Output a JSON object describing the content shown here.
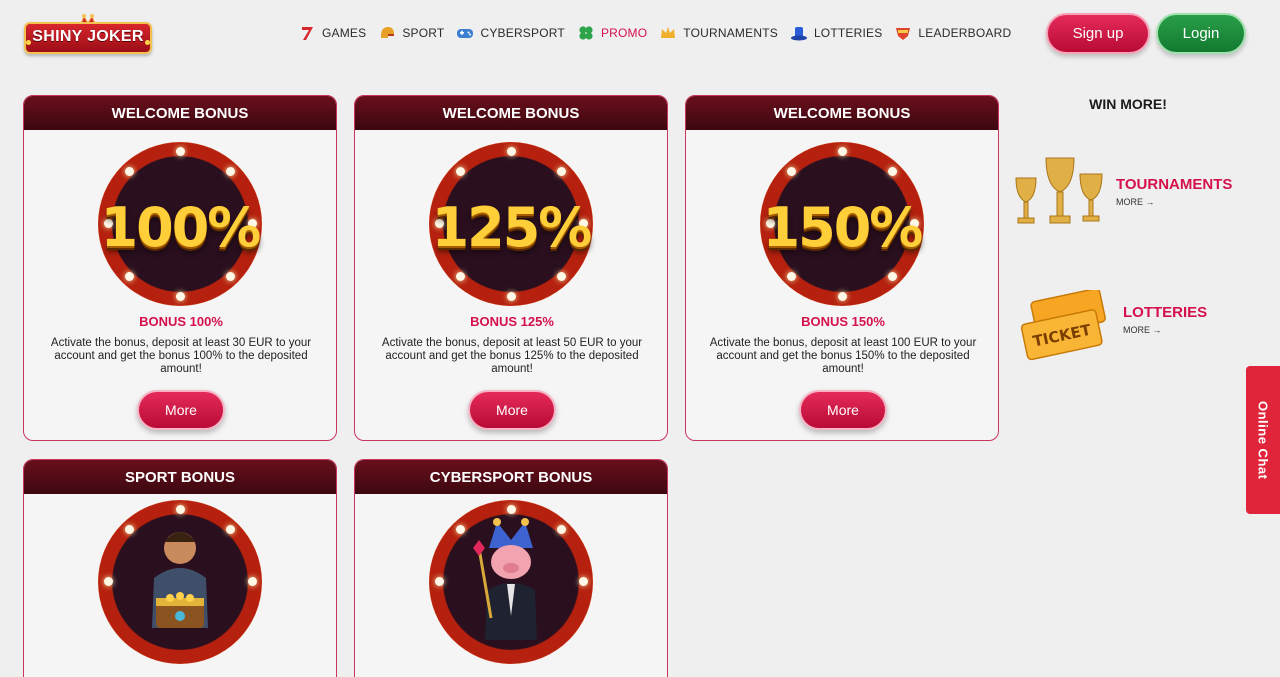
{
  "logo": {
    "text": "SHINY JOKER"
  },
  "nav": {
    "items": [
      {
        "label": "GAMES",
        "icon": "seven-icon",
        "active": false
      },
      {
        "label": "SPORT",
        "icon": "helmet-icon",
        "active": false
      },
      {
        "label": "CYBERSPORT",
        "icon": "gamepad-icon",
        "active": false
      },
      {
        "label": "PROMO",
        "icon": "clover-icon",
        "active": true
      },
      {
        "label": "TOURNAMENTS",
        "icon": "crown-icon",
        "active": false
      },
      {
        "label": "LOTTERIES",
        "icon": "top-hat-icon",
        "active": false
      },
      {
        "label": "LEADERBOARD",
        "icon": "badge-icon",
        "active": false
      }
    ]
  },
  "auth": {
    "signup_label": "Sign up",
    "login_label": "Login"
  },
  "cards": [
    {
      "header": "WELCOME BONUS",
      "badge": "100%",
      "title": "BONUS 100%",
      "desc": "Activate the bonus, deposit at least 30 EUR to your account and get the bonus 100% to the deposited amount!",
      "button": "More"
    },
    {
      "header": "WELCOME BONUS",
      "badge": "125%",
      "title": "BONUS 125%",
      "desc": "Activate the bonus, deposit at least 50 EUR to your account and get the bonus 125% to the deposited amount!",
      "button": "More"
    },
    {
      "header": "WELCOME BONUS",
      "badge": "150%",
      "title": "BONUS 150%",
      "desc": "Activate the bonus, deposit at least 100 EUR to your account and get the bonus 150% to the deposited amount!",
      "button": "More"
    },
    {
      "header": "SPORT BONUS"
    },
    {
      "header": "CYBERSPORT BONUS"
    }
  ],
  "sidebar": {
    "title": "WIN MORE!",
    "items": [
      {
        "label": "TOURNAMENTS",
        "more": "MORE →",
        "icon": "trophies-icon"
      },
      {
        "label": "LOTTERIES",
        "more": "MORE →",
        "icon": "tickets-icon",
        "ticket_text": "TICKET"
      }
    ]
  },
  "online_chat": {
    "label": "Online Chat"
  },
  "colors": {
    "accent": "#d4114b",
    "header_bar": "#4a0b14",
    "login_green": "#1b8a3a",
    "chat_red": "#e0243a"
  }
}
